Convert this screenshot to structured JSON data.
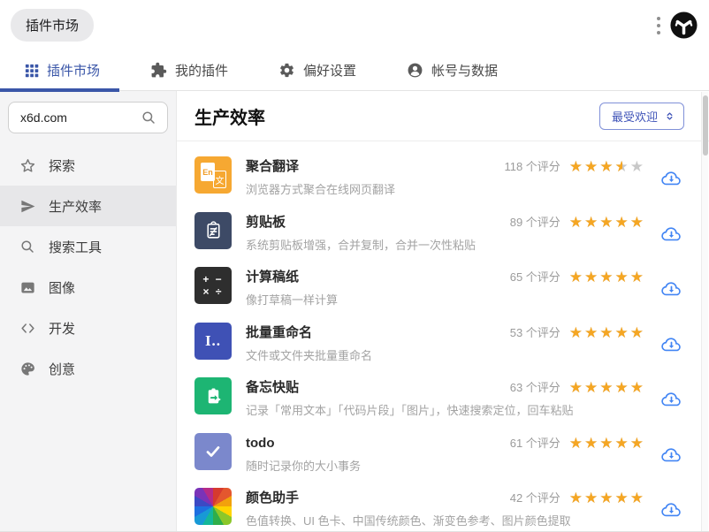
{
  "header": {
    "badge": "插件市场"
  },
  "tabs": [
    {
      "label": "插件市场",
      "icon": "grid-icon",
      "active": true
    },
    {
      "label": "我的插件",
      "icon": "puzzle-icon",
      "active": false
    },
    {
      "label": "偏好设置",
      "icon": "gear-icon",
      "active": false
    },
    {
      "label": "帐号与数据",
      "icon": "person-icon",
      "active": false
    }
  ],
  "sidebar": {
    "search": {
      "value": "x6d.com"
    },
    "items": [
      {
        "label": "探索",
        "icon": "star-icon",
        "active": false
      },
      {
        "label": "生产效率",
        "icon": "send-icon",
        "active": true
      },
      {
        "label": "搜索工具",
        "icon": "search-icon",
        "active": false
      },
      {
        "label": "图像",
        "icon": "image-icon",
        "active": false
      },
      {
        "label": "开发",
        "icon": "code-icon",
        "active": false
      },
      {
        "label": "创意",
        "icon": "palette-icon",
        "active": false
      }
    ]
  },
  "main": {
    "title": "生产效率",
    "sort": {
      "value": "最受欢迎"
    },
    "stars_glyph": "★★★★★",
    "plugins": [
      {
        "name": "聚合翻译",
        "desc": "浏览器方式聚合在线网页翻译",
        "ratings": "118 个评分",
        "stars": 3.5,
        "icon_type": "translate",
        "icon_bg": "#f6a832",
        "icon_text_front": "En",
        "icon_text_back": "文"
      },
      {
        "name": "剪贴板",
        "desc": "系统剪贴板增强，合并复制，合并一次性粘贴",
        "ratings": "89 个评分",
        "stars": 5,
        "icon_type": "clipboard",
        "icon_bg": "#3d4a66"
      },
      {
        "name": "计算稿纸",
        "desc": "像打草稿一样计算",
        "ratings": "65 个评分",
        "stars": 5,
        "icon_type": "calc",
        "icon_bg": "#2e2e2e",
        "icon_line1": "+ −",
        "icon_line2": "× ÷"
      },
      {
        "name": "批量重命名",
        "desc": "文件或文件夹批量重命名",
        "ratings": "53 个评分",
        "stars": 5,
        "icon_type": "rename",
        "icon_bg": "#3f51b5",
        "icon_text": "I.."
      },
      {
        "name": "备忘快贴",
        "desc": "记录「常用文本」「代码片段」「图片」，快速搜索定位，回车粘贴",
        "ratings": "63 个评分",
        "stars": 5,
        "icon_type": "memo",
        "icon_bg": "#1db573"
      },
      {
        "name": "todo",
        "desc": "随时记录你的大小事务",
        "ratings": "61 个评分",
        "stars": 5,
        "icon_type": "check",
        "icon_bg": "#7b88cc"
      },
      {
        "name": "颜色助手",
        "desc": "色值转换、UI 色卡、中国传统颜色、渐变色参考、图片颜色提取",
        "ratings": "42 个评分",
        "stars": 5,
        "icon_type": "colorwheel",
        "icon_bg": ""
      }
    ]
  },
  "colors": {
    "accent": "#3a56a8",
    "star_full": "#f5a623",
    "star_empty": "#c8c8c8",
    "cloud_blue": "#4285f4",
    "sidebar_bg": "#f4f4f5",
    "sidebar_active": "#e7e7e9"
  }
}
